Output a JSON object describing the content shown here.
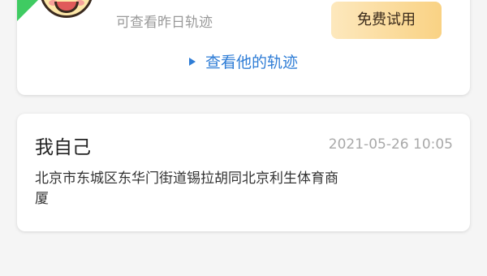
{
  "top_card": {
    "subtitle": "可查看昨日轨迹",
    "trial_button_label": "免费试用",
    "track_link_label": "查看他的轨迹",
    "track_link_icon": "play-triangle-icon",
    "badge_color": "#3fcb62"
  },
  "self_card": {
    "name": "我自己",
    "timestamp": "2021-05-26 10:05",
    "address": "北京市东城区东华门街道锡拉胡同北京利生体育商厦"
  },
  "colors": {
    "link_blue": "#2f7dd6",
    "button_gold": "#f9d284",
    "background": "#f5f5f5"
  }
}
